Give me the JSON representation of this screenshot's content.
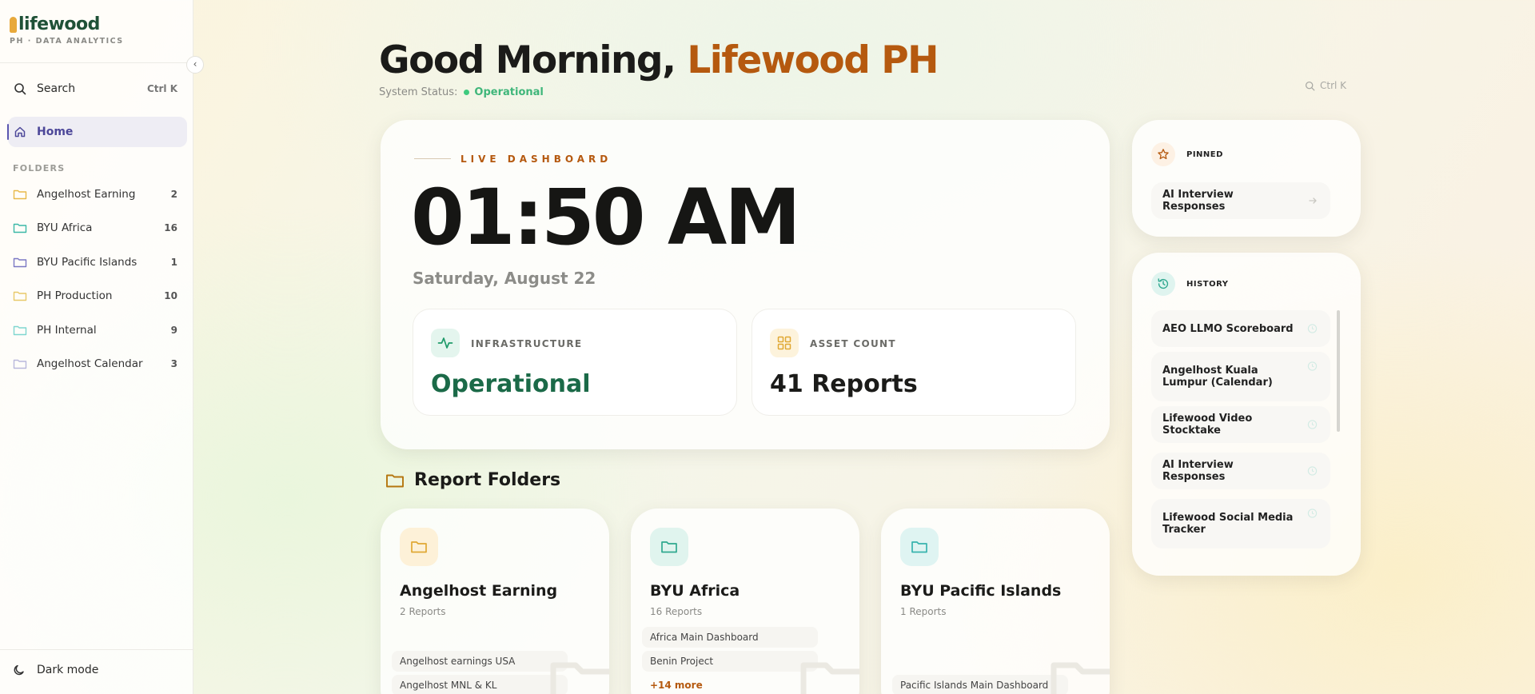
{
  "brand": {
    "name": "lifewood",
    "subtitle": "PH · DATA ANALYTICS"
  },
  "sidebar": {
    "search_label": "Search",
    "search_shortcut": "Ctrl K",
    "home_label": "Home",
    "folders_heading": "FOLDERS",
    "folders": [
      {
        "name": "Angelhost Earning",
        "count": "2",
        "color": "#e8b94a"
      },
      {
        "name": "BYU Africa",
        "count": "16",
        "color": "#3cb8a8"
      },
      {
        "name": "BYU Pacific Islands",
        "count": "1",
        "color": "#7b78c4"
      },
      {
        "name": "PH Production",
        "count": "10",
        "color": "#e8c96a"
      },
      {
        "name": "PH Internal",
        "count": "9",
        "color": "#7fd6d0"
      },
      {
        "name": "Angelhost Calendar",
        "count": "3",
        "color": "#b9b8dc"
      }
    ],
    "dark_mode_label": "Dark mode"
  },
  "header": {
    "greeting": "Good Morning,",
    "name": "Lifewood PH",
    "status_label": "System Status:",
    "status_value": "Operational",
    "search_shortcut": "Ctrl K"
  },
  "dashboard": {
    "eyebrow": "LIVE DASHBOARD",
    "time": "01:50 AM",
    "date": "Saturday, August 22",
    "infrastructure_label": "INFRASTRUCTURE",
    "infrastructure_value": "Operational",
    "asset_label": "ASSET COUNT",
    "asset_value": "41 Reports"
  },
  "report_folders": {
    "title": "Report Folders",
    "cards": [
      {
        "name": "Angelhost Earning",
        "count": "2 Reports",
        "items": [
          "Angelhost earnings USA",
          "Angelhost MNL & KL"
        ]
      },
      {
        "name": "BYU Africa",
        "count": "16 Reports",
        "items": [
          "Africa Main Dashboard",
          "Benin Project"
        ],
        "more": "+14 more"
      },
      {
        "name": "BYU Pacific Islands",
        "count": "1 Reports",
        "items": [
          "Pacific Islands Main Dashboard"
        ]
      }
    ]
  },
  "pinned": {
    "heading": "PINNED",
    "items": [
      "AI Interview Responses"
    ]
  },
  "history": {
    "heading": "HISTORY",
    "items": [
      "AEO LLMO Scoreboard",
      "Angelhost Kuala Lumpur (Calendar)",
      "Lifewood Video Stocktake",
      "AI Interview Responses",
      "Lifewood Social Media Tracker"
    ]
  },
  "colors": {
    "accent": "#b5590f",
    "brand_green": "#1f5137",
    "status_green": "#3fb67a",
    "operational_green": "#1b6a48",
    "nav_active": "#4c4799"
  }
}
